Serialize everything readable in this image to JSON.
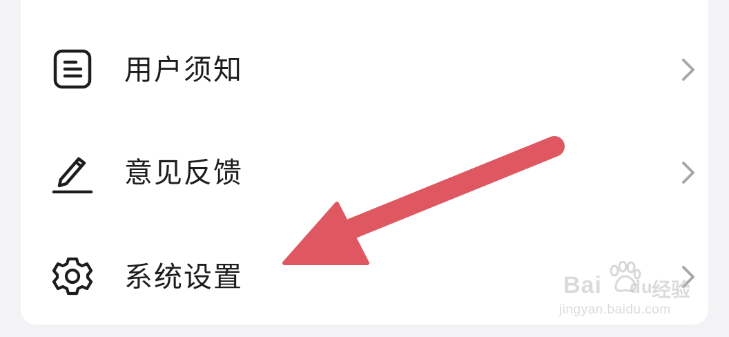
{
  "menu": {
    "items": [
      {
        "label": "用户须知",
        "icon": "document-icon"
      },
      {
        "label": "意见反馈",
        "icon": "pencil-icon"
      },
      {
        "label": "系统设置",
        "icon": "gear-icon"
      }
    ]
  },
  "annotation": {
    "icon": "red-arrow-icon",
    "color": "#de5761"
  },
  "watermark": {
    "brand": "Bai",
    "brand_suffix": "du",
    "brand_cn": "经验",
    "url": "jingyan.baidu.com"
  },
  "colors": {
    "background": "#f3f3f5",
    "card": "#ffffff",
    "text": "#1d1d1f",
    "chevron": "#a8a8ac"
  }
}
